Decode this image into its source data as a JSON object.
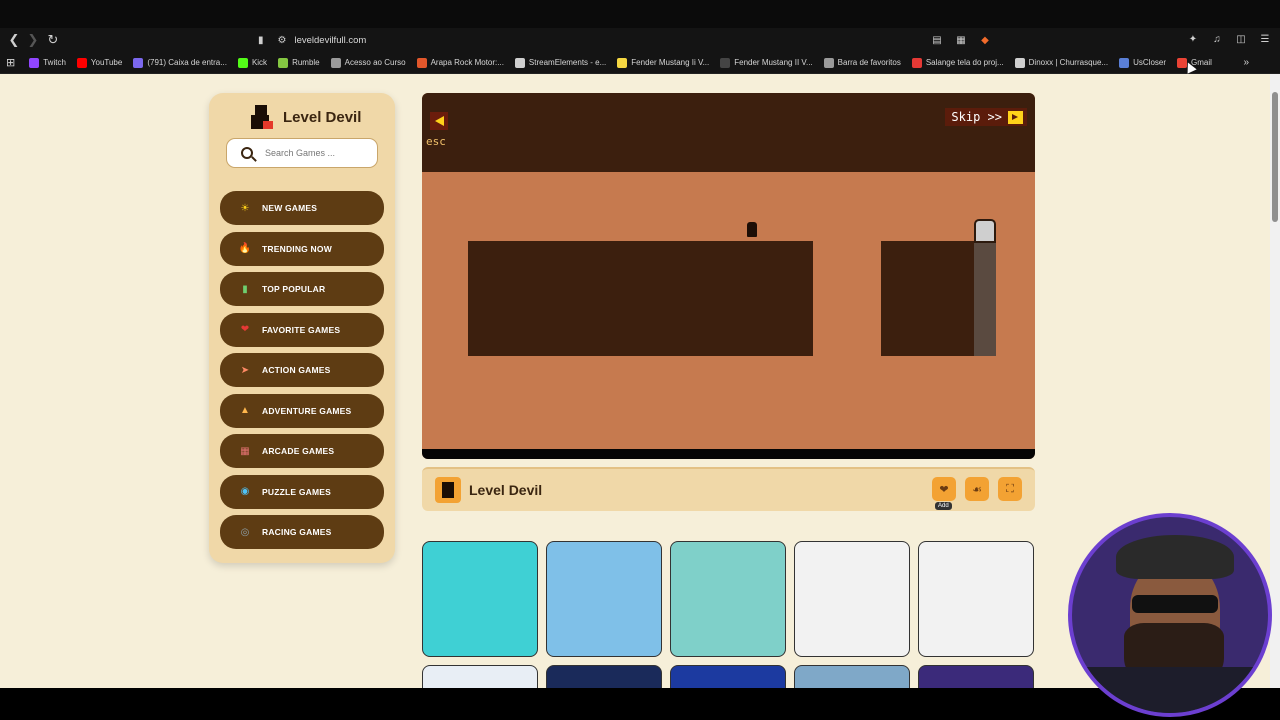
{
  "browser": {
    "url": "leveldevilfull.com",
    "bookmarks": [
      {
        "label": "Twitch",
        "color": "#9146ff"
      },
      {
        "label": "YouTube",
        "color": "#ff0000"
      },
      {
        "label": "(791) Caixa de entra...",
        "color": "#7b68ee"
      },
      {
        "label": "Kick",
        "color": "#53fc18"
      },
      {
        "label": "Rumble",
        "color": "#85c742"
      },
      {
        "label": "Acesso ao Curso",
        "color": "#9a9a9a"
      },
      {
        "label": "Arapa Rock Motor:...",
        "color": "#e2572b"
      },
      {
        "label": "StreamElements - e...",
        "color": "#cfcfcf"
      },
      {
        "label": "Fender Mustang Ii V...",
        "color": "#f5d742"
      },
      {
        "label": "Fender Mustang II V...",
        "color": "#444444"
      },
      {
        "label": "Barra de favoritos",
        "color": "#9a9a9a"
      },
      {
        "label": "Salange tela do proj...",
        "color": "#e53935"
      },
      {
        "label": "Dinoxx | Churrasque...",
        "color": "#cfcfcf"
      },
      {
        "label": "UsCloser",
        "color": "#5a7fd6"
      },
      {
        "label": "Gmail",
        "color": "#ea4335"
      }
    ]
  },
  "sidebar": {
    "logo_text": "Level Devil",
    "search_placeholder": "Search Games ...",
    "menu": [
      {
        "label": "NEW GAMES",
        "icon": "sun-icon",
        "color": "#ffd21a"
      },
      {
        "label": "TRENDING NOW",
        "icon": "fire-icon",
        "color": "#ff5a1f"
      },
      {
        "label": "TOP POPULAR",
        "icon": "bar-chart-icon",
        "color": "#6fcf6f"
      },
      {
        "label": "FAVORITE GAMES",
        "icon": "heart-icon",
        "color": "#e53935"
      },
      {
        "label": "ACTION GAMES",
        "icon": "rocket-icon",
        "color": "#ff8a65"
      },
      {
        "label": "ADVENTURE GAMES",
        "icon": "tent-icon",
        "color": "#ffb74d"
      },
      {
        "label": "ARCADE GAMES",
        "icon": "arcade-icon",
        "color": "#e57373"
      },
      {
        "label": "PUZZLE GAMES",
        "icon": "puzzle-icon",
        "color": "#4fc3f7"
      },
      {
        "label": "RACING GAMES",
        "icon": "wheel-icon",
        "color": "#90a4ae"
      }
    ]
  },
  "game": {
    "back_label": "esc",
    "skip_label": "Skip >>"
  },
  "title_bar": {
    "title": "Level Devil",
    "add_label": "Add"
  },
  "thumbnails": [
    {
      "name": "basketball-game",
      "bg": "#3fd0d4"
    },
    {
      "name": "getting-over-it",
      "bg": "#7fc0e8"
    },
    {
      "name": "vex6",
      "bg": "#7fd0c9"
    },
    {
      "name": "vex5",
      "bg": "#f2f2f2"
    },
    {
      "name": "vex4",
      "bg": "#f2f2f2"
    }
  ]
}
